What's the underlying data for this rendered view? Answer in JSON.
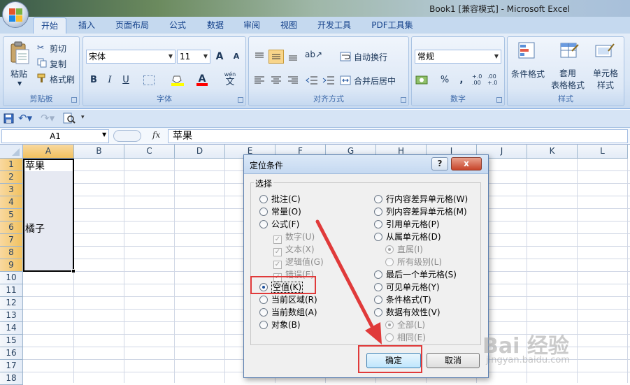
{
  "window": {
    "title": "Book1  [兼容模式] - Microsoft Excel"
  },
  "tabs": [
    "开始",
    "插入",
    "页面布局",
    "公式",
    "数据",
    "审阅",
    "视图",
    "开发工具",
    "PDF工具集"
  ],
  "ribbon": {
    "clipboard": {
      "paste": "粘贴",
      "cut": "剪切",
      "copy": "复制",
      "format_painter": "格式刷",
      "label": "剪贴板"
    },
    "font": {
      "name": "宋体",
      "size": "11",
      "bold": "B",
      "italic": "I",
      "underline": "U",
      "label": "字体",
      "grow": "A",
      "shrink": "A",
      "wen": "wén",
      "wen_char": "文"
    },
    "alignment": {
      "wrap": "自动换行",
      "merge": "合并后居中",
      "label": "对齐方式"
    },
    "number": {
      "format": "常规",
      "percent": "%",
      "comma": ",",
      "inc_decimal": "+.0\n.00",
      "dec_decimal": ".00\n+.0",
      "label": "数字"
    },
    "styles": {
      "conditional": "条件格式",
      "table": "套用\n表格格式",
      "cell": "单元格\n样式",
      "label": "样式"
    }
  },
  "formula_bar": {
    "cell_ref": "A1",
    "fx": "fx",
    "content": "苹果"
  },
  "sheet": {
    "columns": [
      "A",
      "B",
      "C",
      "D",
      "E",
      "F",
      "G",
      "H",
      "I",
      "J",
      "K",
      "L"
    ],
    "rows": [
      "1",
      "2",
      "3",
      "4",
      "5",
      "6",
      "7",
      "8",
      "9",
      "10",
      "11",
      "12",
      "13",
      "14",
      "15",
      "16",
      "17",
      "18"
    ],
    "cells": {
      "A1": "苹果",
      "A6": "橘子"
    }
  },
  "dialog": {
    "title": "定位条件",
    "help": "?",
    "close": "x",
    "group_label": "选择",
    "left_options": [
      {
        "label": "批注(C)",
        "type": "radio",
        "state": "off"
      },
      {
        "label": "常量(O)",
        "type": "radio",
        "state": "off"
      },
      {
        "label": "公式(F)",
        "type": "radio",
        "state": "off"
      },
      {
        "label": "数字(U)",
        "type": "check",
        "state": "on-disabled"
      },
      {
        "label": "文本(X)",
        "type": "check",
        "state": "on-disabled"
      },
      {
        "label": "逻辑值(G)",
        "type": "check",
        "state": "on-disabled"
      },
      {
        "label": "错误(E)",
        "type": "check",
        "state": "on-disabled"
      },
      {
        "label": "空值(K)",
        "type": "radio",
        "state": "on"
      },
      {
        "label": "当前区域(R)",
        "type": "radio",
        "state": "off"
      },
      {
        "label": "当前数组(A)",
        "type": "radio",
        "state": "off"
      },
      {
        "label": "对象(B)",
        "type": "radio",
        "state": "off"
      }
    ],
    "right_options": [
      {
        "label": "行内容差异单元格(W)",
        "type": "radio",
        "state": "off"
      },
      {
        "label": "列内容差异单元格(M)",
        "type": "radio",
        "state": "off"
      },
      {
        "label": "引用单元格(P)",
        "type": "radio",
        "state": "off"
      },
      {
        "label": "从属单元格(D)",
        "type": "radio",
        "state": "off"
      },
      {
        "label": "直属(I)",
        "type": "radio",
        "state": "on-disabled"
      },
      {
        "label": "所有级别(L)",
        "type": "radio",
        "state": "off-disabled"
      },
      {
        "label": "最后一个单元格(S)",
        "type": "radio",
        "state": "off"
      },
      {
        "label": "可见单元格(Y)",
        "type": "radio",
        "state": "off"
      },
      {
        "label": "条件格式(T)",
        "type": "radio",
        "state": "off"
      },
      {
        "label": "数据有效性(V)",
        "type": "radio",
        "state": "off"
      },
      {
        "label": "全部(L)",
        "type": "radio",
        "state": "on-disabled"
      },
      {
        "label": "相同(E)",
        "type": "radio",
        "state": "off-disabled"
      }
    ],
    "ok": "确定",
    "cancel": "取消"
  },
  "watermark": {
    "brand": "Bai 经验",
    "url": "jingyan.baidu.com"
  },
  "colors": {
    "annotation": "#e03a3a",
    "selection": "#f1c15f",
    "accent": "#15428b"
  }
}
